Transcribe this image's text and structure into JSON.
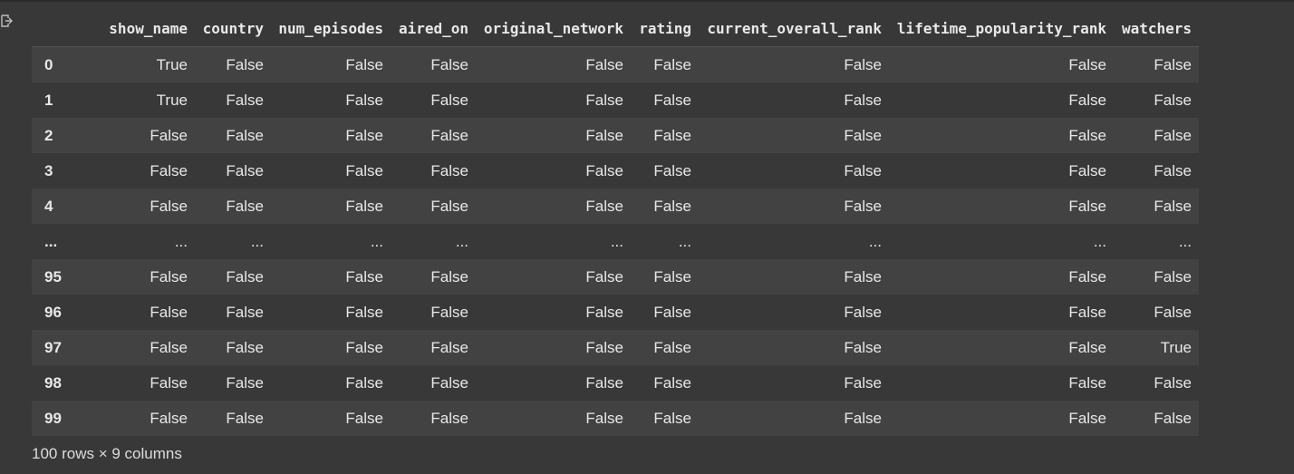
{
  "output": {
    "icon": "output-arrow-icon"
  },
  "table": {
    "columns": [
      "show_name",
      "country",
      "num_episodes",
      "aired_on",
      "original_network",
      "rating",
      "current_overall_rank",
      "lifetime_popularity_rank",
      "watchers"
    ],
    "rows": [
      {
        "index": "0",
        "cells": [
          "True",
          "False",
          "False",
          "False",
          "False",
          "False",
          "False",
          "False",
          "False"
        ]
      },
      {
        "index": "1",
        "cells": [
          "True",
          "False",
          "False",
          "False",
          "False",
          "False",
          "False",
          "False",
          "False"
        ]
      },
      {
        "index": "2",
        "cells": [
          "False",
          "False",
          "False",
          "False",
          "False",
          "False",
          "False",
          "False",
          "False"
        ]
      },
      {
        "index": "3",
        "cells": [
          "False",
          "False",
          "False",
          "False",
          "False",
          "False",
          "False",
          "False",
          "False"
        ]
      },
      {
        "index": "4",
        "cells": [
          "False",
          "False",
          "False",
          "False",
          "False",
          "False",
          "False",
          "False",
          "False"
        ]
      },
      {
        "index": "...",
        "cells": [
          "...",
          "...",
          "...",
          "...",
          "...",
          "...",
          "...",
          "...",
          "..."
        ]
      },
      {
        "index": "95",
        "cells": [
          "False",
          "False",
          "False",
          "False",
          "False",
          "False",
          "False",
          "False",
          "False"
        ]
      },
      {
        "index": "96",
        "cells": [
          "False",
          "False",
          "False",
          "False",
          "False",
          "False",
          "False",
          "False",
          "False"
        ]
      },
      {
        "index": "97",
        "cells": [
          "False",
          "False",
          "False",
          "False",
          "False",
          "False",
          "False",
          "False",
          "True"
        ]
      },
      {
        "index": "98",
        "cells": [
          "False",
          "False",
          "False",
          "False",
          "False",
          "False",
          "False",
          "False",
          "False"
        ]
      },
      {
        "index": "99",
        "cells": [
          "False",
          "False",
          "False",
          "False",
          "False",
          "False",
          "False",
          "False",
          "False"
        ]
      }
    ]
  },
  "footer": {
    "shape_text": "100 rows × 9 columns"
  },
  "colors": {
    "background": "#383838",
    "row_alt": "#424242",
    "text": "#e8e8e8"
  }
}
